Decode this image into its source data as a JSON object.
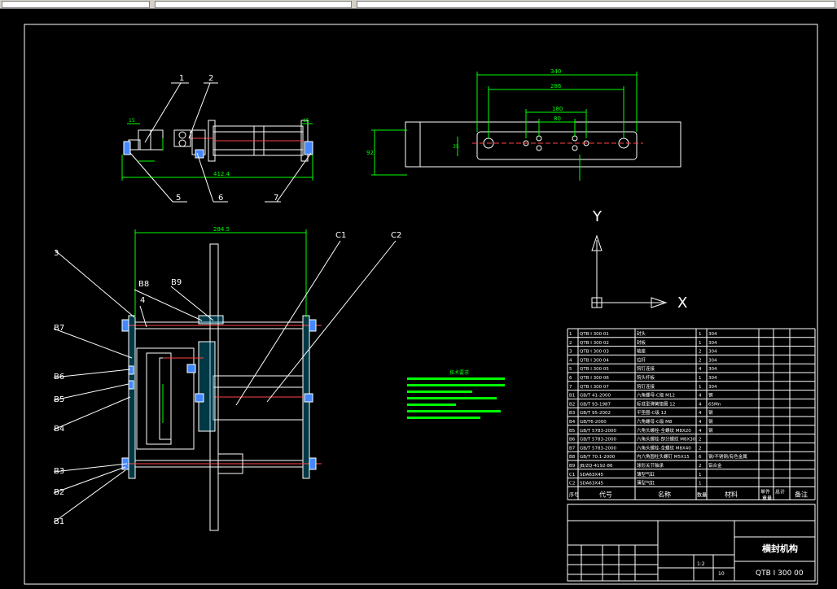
{
  "axis": {
    "x": "X",
    "y": "Y"
  },
  "balloons": {
    "top": [
      "1",
      "2"
    ],
    "bottom": [
      "5",
      "6",
      "7"
    ],
    "right": [
      "C1",
      "C2"
    ],
    "left": [
      "3",
      "B8",
      "B9",
      "4",
      "B7",
      "B6",
      "B5",
      "B4",
      "B3",
      "B2",
      "B1"
    ]
  },
  "dims": {
    "top_view_overall": "412.4",
    "front_width": "284.5",
    "plate_outer": "340",
    "plate_mid": "286",
    "plate_inner": "180",
    "plate_hole": "80",
    "plate_height": "92",
    "plate_side": "35",
    "small_left": "15",
    "small_right": "15"
  },
  "notes_title": "技术要求",
  "bom": {
    "rows": [
      [
        "1",
        "QTB I 300 01",
        "封头",
        "1",
        "304"
      ],
      [
        "2",
        "QTB I 300 02",
        "封板",
        "1",
        "304"
      ],
      [
        "3",
        "QTB I 300 03",
        "轴座",
        "2",
        "304"
      ],
      [
        "4",
        "QTB I 300 04",
        "拉杆",
        "2",
        "304"
      ],
      [
        "5",
        "QTB I 300 05",
        "钩钉连接",
        "4",
        "304"
      ],
      [
        "6",
        "QTB I 300 06",
        "钩头杆板",
        "1",
        "304"
      ],
      [
        "7",
        "QTB I 300 07",
        "钩钉连接",
        "1",
        "304"
      ],
      [
        "B1",
        "GB/T 41-2000",
        "六角螺母-C级 M12",
        "4",
        "钢"
      ],
      [
        "B2",
        "GB/T 93-1987",
        "标准型弹簧垫圈 12",
        "4",
        "65Mn"
      ],
      [
        "B3",
        "GB/T 95-2002",
        "平垫圈-C级 12",
        "4",
        "钢"
      ],
      [
        "B4",
        "GB/T6-2000",
        "六角螺母-C级 M8",
        "4",
        "钢"
      ],
      [
        "B5",
        "GB/T 5783-2000",
        "六角头螺栓-全螺纹 M8X20",
        "4",
        "钢"
      ],
      [
        "B6",
        "GB/T 5783-2000",
        "六角头螺栓-部分螺纹 M8X30",
        "2",
        ""
      ],
      [
        "B7",
        "GB/T 5783-2000",
        "六角头螺栓-全螺纹 M8X40",
        "2",
        ""
      ],
      [
        "B8",
        "GB/T 70.1-2000",
        "内六角圆柱头螺钉 M5X15",
        "6",
        "钢/不锈钢/有色金属"
      ],
      [
        "B9",
        "JB/ZQ-4192-86",
        "球形关节轴承",
        "2",
        "铝合金"
      ],
      [
        "C1",
        "SDA63X45",
        "薄型气缸",
        "1",
        ""
      ],
      [
        "C2",
        "SDA63X45",
        "薄型气缸",
        "1",
        ""
      ]
    ],
    "header": [
      "序号",
      "代号",
      "名称",
      "数量",
      "材料",
      "单件",
      "总计",
      "备注",
      "重量"
    ],
    "title_name": "横封机构",
    "drawing_no": "QTB I 300 00",
    "scale": "1:2",
    "sheet": "10"
  }
}
